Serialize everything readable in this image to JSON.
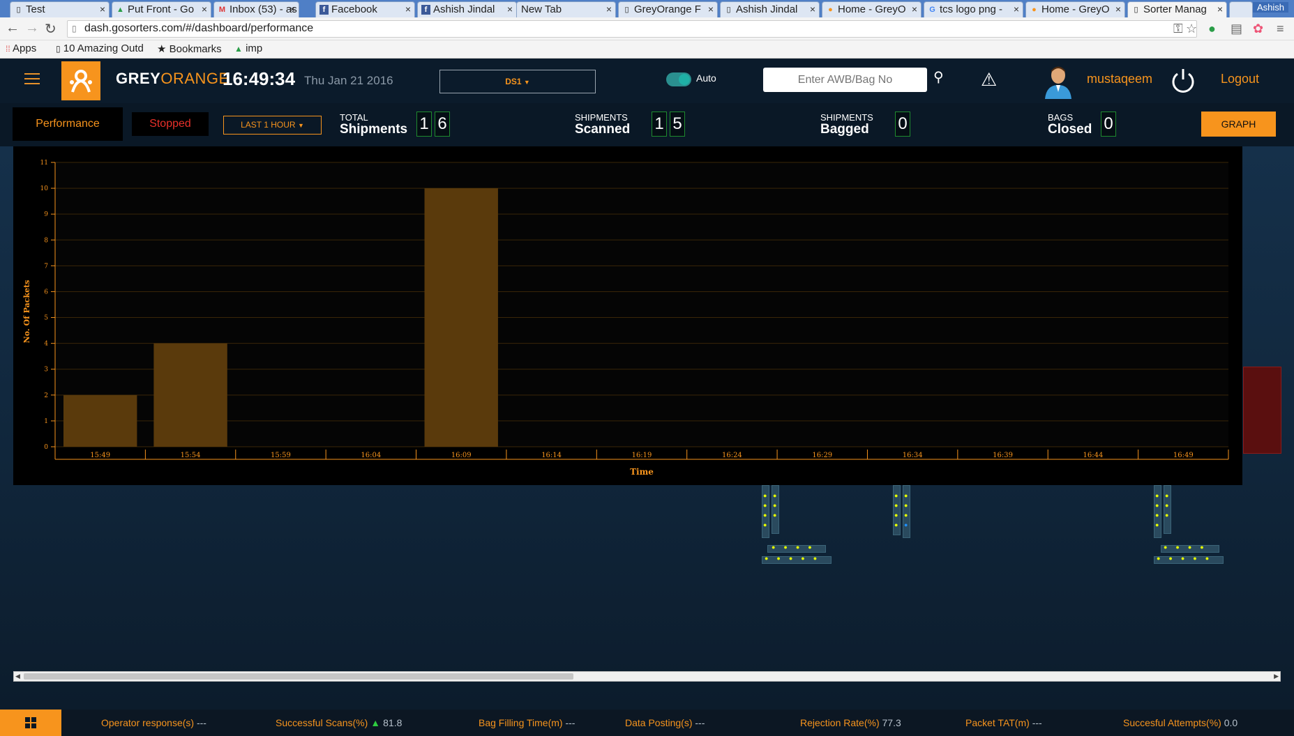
{
  "browser": {
    "tabs": [
      {
        "title": "Test",
        "icon": "document-icon"
      },
      {
        "title": "Put Front - Go",
        "icon": "drive-icon"
      },
      {
        "title": "Inbox (53) - as",
        "icon": "gmail-icon"
      },
      {
        "title": "Facebook",
        "icon": "facebook-icon"
      },
      {
        "title": "Ashish Jindal",
        "icon": "facebook-icon"
      },
      {
        "title": "New Tab",
        "icon": ""
      },
      {
        "title": "GreyOrange F",
        "icon": "document-icon"
      },
      {
        "title": "Ashish Jindal",
        "icon": "document-icon"
      },
      {
        "title": "Home - GreyO",
        "icon": "greyorange-icon"
      },
      {
        "title": "tcs logo png -",
        "icon": "google-icon"
      },
      {
        "title": "Home - GreyO",
        "icon": "greyorange-icon"
      },
      {
        "title": "Sorter Manag",
        "icon": "document-icon"
      }
    ],
    "profile_name": "Ashish",
    "url": "dash.gosorters.com/#/dashboard/performance",
    "bookmarks": [
      "Apps",
      "10 Amazing Outd",
      "Bookmarks",
      "imp"
    ]
  },
  "header": {
    "brand_grey": "GREY",
    "brand_orange": "ORANGE",
    "time": "16:49:34",
    "date": "Thu Jan 21 2016",
    "sorter_select": "DS1",
    "auto_label": "Auto",
    "auto_enabled": true,
    "search_placeholder": "Enter AWB/Bag No",
    "username": "mustaqeem",
    "logout": "Logout"
  },
  "stats": {
    "performance_tab": "Performance",
    "status": "Stopped",
    "range": "LAST 1 HOUR",
    "total": {
      "small": "TOTAL",
      "big": "Shipments",
      "digits": [
        "1",
        "6"
      ]
    },
    "scanned": {
      "small": "SHIPMENTS",
      "big": "Scanned",
      "digits": [
        "1",
        "5"
      ]
    },
    "bagged": {
      "small": "SHIPMENTS",
      "big": "Bagged",
      "digits": [
        "0"
      ]
    },
    "closed": {
      "small": "BAGS",
      "big": "Closed",
      "digits": [
        "0"
      ]
    },
    "graph_button": "GRAPH"
  },
  "chart_data": {
    "type": "bar",
    "categories": [
      "15:49",
      "15:54",
      "15:59",
      "16:04",
      "16:09",
      "16:14",
      "16:19",
      "16:24",
      "16:29",
      "16:34",
      "16:39",
      "16:44",
      "16:49"
    ],
    "values": [
      2,
      4,
      0,
      0,
      10,
      0,
      0,
      0,
      0,
      0,
      0,
      0,
      0
    ],
    "xlabel": "Time",
    "ylabel": "No. Of Packets",
    "ylim": [
      0,
      11
    ],
    "yticks": [
      "0",
      "1",
      "2",
      "3",
      "4",
      "5",
      "6",
      "7",
      "8",
      "9",
      "10",
      "11"
    ],
    "grid": true,
    "bar_color": "#5a3a0c",
    "axis_color": "#f7941d"
  },
  "footer": {
    "metrics": [
      {
        "label": "Operator response(s)",
        "value": "---"
      },
      {
        "label": "Successful Scans(%)",
        "value": "81.8",
        "trend": "up"
      },
      {
        "label": "Bag Filling Time(m)",
        "value": "---"
      },
      {
        "label": "Data Posting(s)",
        "value": "---"
      },
      {
        "label": "Rejection Rate(%)",
        "value": "77.3"
      },
      {
        "label": "Packet TAT(m)",
        "value": "---"
      },
      {
        "label": "Succesful Attempts(%)",
        "value": "0.0"
      }
    ]
  },
  "colors": {
    "accent": "#f7941d",
    "stopped": "#e8302a",
    "digit_border": "#1e8a2e",
    "header_bg": "#0b1b2b"
  }
}
